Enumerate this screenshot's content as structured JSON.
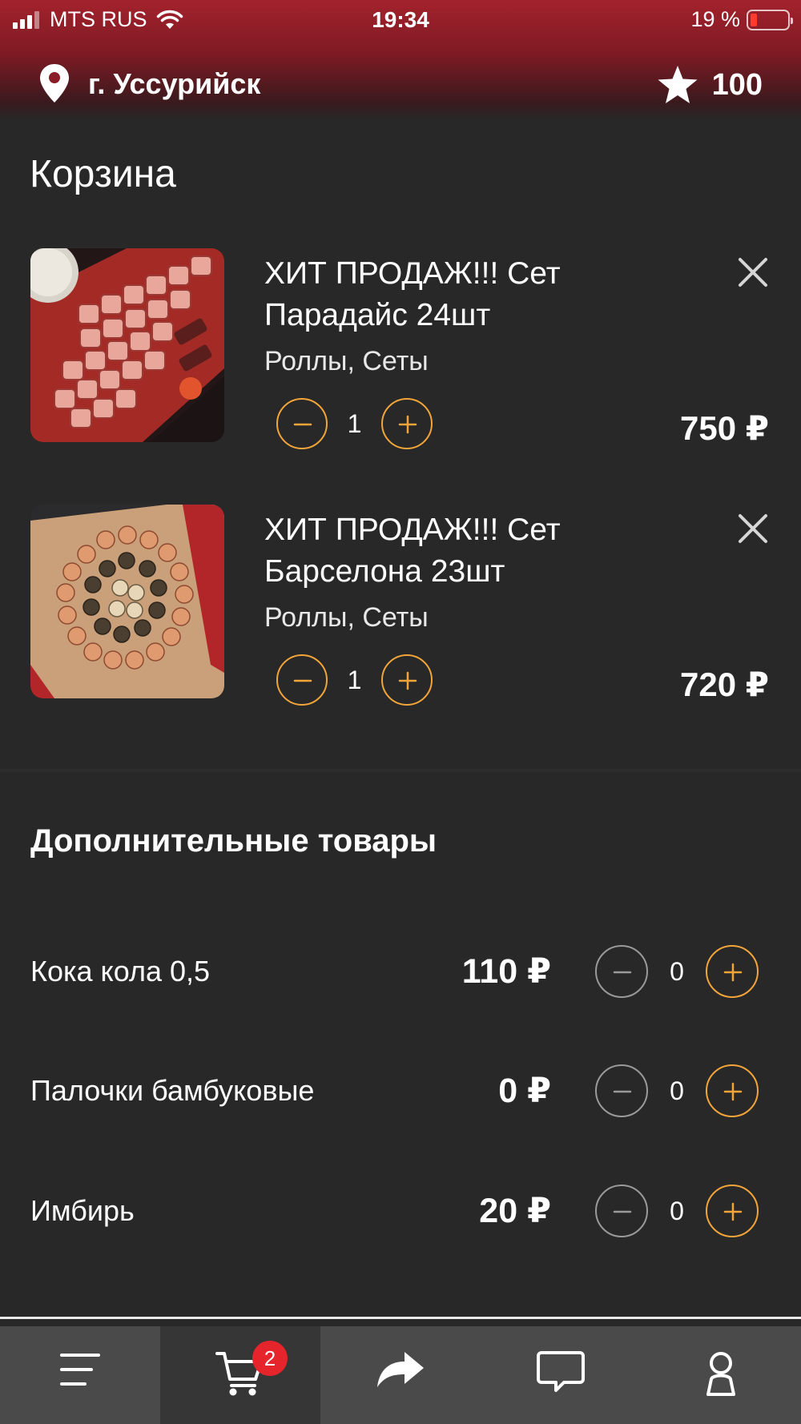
{
  "status_bar": {
    "carrier": "MTS RUS",
    "time": "19:34",
    "battery": "19 %",
    "battery_level": 0.19
  },
  "header": {
    "city": "г. Уссурийск",
    "points": "100",
    "pin_icon": "location-pin-icon",
    "star_icon": "star-icon"
  },
  "cart": {
    "title": "Корзина",
    "items": [
      {
        "name": "ХИТ ПРОДАЖ!!! Сет Парадайс 24шт",
        "category": "Роллы, Сеты",
        "quantity": "1",
        "price": "750 ₽"
      },
      {
        "name": "ХИТ ПРОДАЖ!!! Сет Барселона 23шт",
        "category": "Роллы, Сеты",
        "quantity": "1",
        "price": "720 ₽"
      }
    ]
  },
  "extras": {
    "title": "Дополнительные товары",
    "items": [
      {
        "name": "Кока кола 0,5",
        "price": "110 ₽",
        "quantity": "0"
      },
      {
        "name": "Палочки бамбуковые",
        "price": "0 ₽",
        "quantity": "0"
      },
      {
        "name": "Имбирь",
        "price": "20 ₽",
        "quantity": "0"
      }
    ]
  },
  "tabbar": {
    "cart_badge": "2",
    "tabs": [
      "menu-icon",
      "cart-icon",
      "share-icon",
      "chat-icon",
      "profile-icon"
    ]
  },
  "colors": {
    "accent": "#f3a53a",
    "header_red": "#a3222c",
    "background": "#282828",
    "tabbar": "#4a4a4a",
    "badge": "#e5252b"
  }
}
